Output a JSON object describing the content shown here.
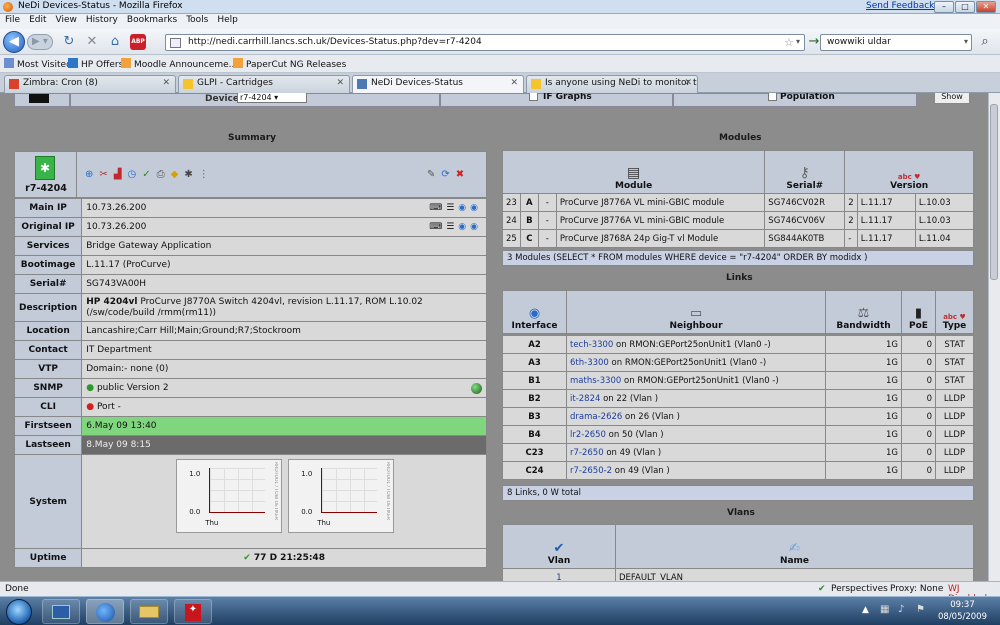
{
  "window": {
    "title": "NeDi Devices-Status - Mozilla Firefox",
    "send_feedback": "Send Feedback"
  },
  "menu": [
    "File",
    "Edit",
    "View",
    "History",
    "Bookmarks",
    "Tools",
    "Help"
  ],
  "nav": {
    "url": "http://nedi.carrhill.lancs.sch.uk/Devices-Status.php?dev=r7-4204",
    "search_value": "wowwiki uldar",
    "abp_label": "ABP"
  },
  "bookmarks": [
    "Most Visited",
    "HP Offers",
    "Moodle Announceme...",
    "PaperCut NG Releases"
  ],
  "tabs": [
    "Zimbra: Cron (8)",
    "GLPI - Cartridges",
    "NeDi Devices-Status",
    "Is anyone using NeDi to monitor th..."
  ],
  "top_strip": {
    "device_label": "Device",
    "device_value": "r7-4204",
    "if_graphs": "IF Graphs",
    "population": "Population",
    "show_button": "Show"
  },
  "summary": {
    "title": "Summary",
    "device_name": "r7-4204",
    "rows": [
      {
        "label": "Main IP",
        "value": "10.73.26.200"
      },
      {
        "label": "Original IP",
        "value": "10.73.26.200"
      },
      {
        "label": "Services",
        "value": "Bridge Gateway Application"
      },
      {
        "label": "Bootimage",
        "value": "L.11.17 (ProCurve)"
      },
      {
        "label": "Serial#",
        "value": "SG743VA00H"
      },
      {
        "label": "Description",
        "value_bold": "HP 4204vl",
        "value": "ProCurve J8770A Switch 4204vl, revision L.11.17, ROM L.10.02 (/sw/code/build /rmm(rm11))"
      },
      {
        "label": "Location",
        "value": "Lancashire;Carr Hill;Main;Ground;R7;Stockroom"
      },
      {
        "label": "Contact",
        "value": "IT Department"
      },
      {
        "label": "VTP",
        "value": "Domain:- none (0)"
      },
      {
        "label": "SNMP",
        "value": "public Version 2"
      },
      {
        "label": "CLI",
        "value": "Port -"
      },
      {
        "label": "Firstseen",
        "value": "6.May 09 13:40"
      },
      {
        "label": "Lastseen",
        "value": "8.May 09 8:15"
      },
      {
        "label": "System",
        "value": ""
      },
      {
        "label": "Uptime",
        "value": "77 D 21:25:48"
      }
    ],
    "graph": {
      "y_top": "1.0",
      "y_bottom": "0.0",
      "x_label": "Thu",
      "side_label": "RRDTOOL / TOBI OETIKER"
    },
    "colors": {
      "firstseen_bg": "#7fd67f",
      "lastseen_bg": "#6b6b6b",
      "header_bg": "#c3cbd9"
    }
  },
  "modules": {
    "title": "Modules",
    "headers": [
      "Module",
      "Serial#",
      "Version"
    ],
    "rows": [
      {
        "slot": "23",
        "letter": "A",
        "dash": "-",
        "desc": "ProCurve J8776A VL mini-GBIC module",
        "serial": "SG746CV02R",
        "hw": "2",
        "fw": "L.11.17",
        "sw": "L.10.03"
      },
      {
        "slot": "24",
        "letter": "B",
        "dash": "-",
        "desc": "ProCurve J8776A VL mini-GBIC module",
        "serial": "SG746CV06V",
        "hw": "2",
        "fw": "L.11.17",
        "sw": "L.10.03"
      },
      {
        "slot": "25",
        "letter": "C",
        "dash": "-",
        "desc": "ProCurve J8768A 24p Gig-T vl Module",
        "serial": "SG844AK0TB",
        "hw": "-",
        "fw": "L.11.17",
        "sw": "L.11.04"
      }
    ],
    "footer": "3 Modules (SELECT * FROM modules WHERE device = \"r7-4204\" ORDER BY modidx )"
  },
  "links": {
    "title": "Links",
    "headers": [
      "Interface",
      "Neighbour",
      "Bandwidth",
      "PoE",
      "Type"
    ],
    "rows": [
      {
        "iface": "A2",
        "neighbour": "tech-3300",
        "info": "on RMON:GEPort25onUnit1 (Vlan0 -)",
        "bw": "1G",
        "poe": "0",
        "type": "STAT"
      },
      {
        "iface": "A3",
        "neighbour": "6th-3300",
        "info": "on RMON:GEPort25onUnit1 (Vlan0 -)",
        "bw": "1G",
        "poe": "0",
        "type": "STAT"
      },
      {
        "iface": "B1",
        "neighbour": "maths-3300",
        "info": "on RMON:GEPort25onUnit1 (Vlan0 -)",
        "bw": "1G",
        "poe": "0",
        "type": "STAT"
      },
      {
        "iface": "B2",
        "neighbour": "it-2824",
        "info": "on 22 (Vlan )",
        "bw": "1G",
        "poe": "0",
        "type": "LLDP"
      },
      {
        "iface": "B3",
        "neighbour": "drama-2626",
        "info": "on 26 (Vlan )",
        "bw": "1G",
        "poe": "0",
        "type": "LLDP"
      },
      {
        "iface": "B4",
        "neighbour": "lr2-2650",
        "info": "on 50 (Vlan )",
        "bw": "1G",
        "poe": "0",
        "type": "LLDP"
      },
      {
        "iface": "C23",
        "neighbour": "r7-2650",
        "info": "on 49 (Vlan )",
        "bw": "1G",
        "poe": "0",
        "type": "LLDP"
      },
      {
        "iface": "C24",
        "neighbour": "r7-2650-2",
        "info": "on 49 (Vlan )",
        "bw": "1G",
        "poe": "0",
        "type": "LLDP"
      }
    ],
    "footer": "8 Links, 0 W total"
  },
  "vlans": {
    "title": "Vlans",
    "headers": [
      "Vlan",
      "Name"
    ],
    "rows": [
      {
        "vlan": "1",
        "name": "DEFAULT_VLAN"
      }
    ]
  },
  "statusbar": {
    "status": "Done",
    "perspectives": "Perspectives",
    "proxy": "Proxy: None",
    "wj": "WJ Disabled"
  },
  "taskbar": {
    "time": "09:37",
    "date": "08/05/2009"
  }
}
